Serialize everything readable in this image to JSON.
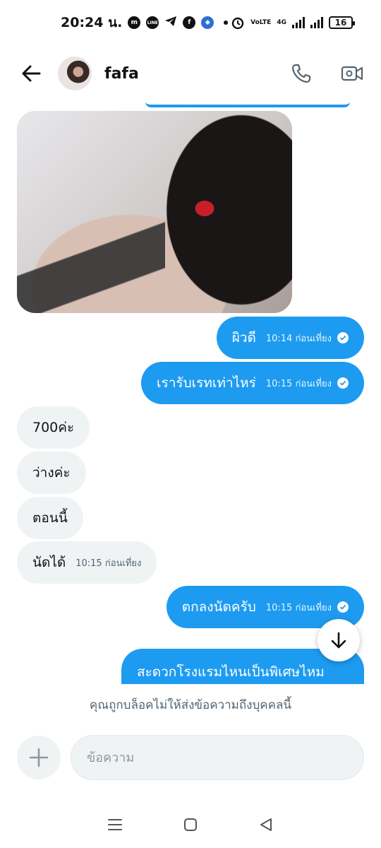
{
  "status_bar": {
    "time": "20:24 น.",
    "network_label": "VoLTE",
    "network_type": "4G",
    "battery": "16",
    "app_icons": [
      "messenger-icon",
      "line-icon",
      "telegram-icon",
      "facebook-icon",
      "app-icon"
    ]
  },
  "header": {
    "contact_name": "fafa"
  },
  "messages": [
    {
      "direction": "out",
      "text": "ผิวดี",
      "time": "10:14 ก่อนเที่ยง"
    },
    {
      "direction": "out",
      "text": "เรารับเรทเท่าไหร่",
      "time": "10:15 ก่อนเที่ยง"
    },
    {
      "direction": "in",
      "text": "700ค่ะ",
      "time": ""
    },
    {
      "direction": "in",
      "text": "ว่างค่ะ",
      "time": ""
    },
    {
      "direction": "in",
      "text": "ตอนนี้",
      "time": ""
    },
    {
      "direction": "in",
      "text": "นัดได้",
      "time": "10:15 ก่อนเที่ยง"
    },
    {
      "direction": "out",
      "text": "ตกลงนัดครับ",
      "time": "10:15 ก่อนเที่ยง"
    },
    {
      "direction": "out",
      "text": "สะดวกโรงแรมไหนเป็นพิเศษไหม",
      "time": ""
    }
  ],
  "blocked_notice": "คุณถูกบล็อคไม่ให้ส่งข้อความถึงบุคคลนี้",
  "composer": {
    "placeholder": "ข้อความ"
  },
  "colors": {
    "accent": "#1d9bf0",
    "incoming_bubble": "#eff3f4",
    "muted_text": "#536471"
  }
}
